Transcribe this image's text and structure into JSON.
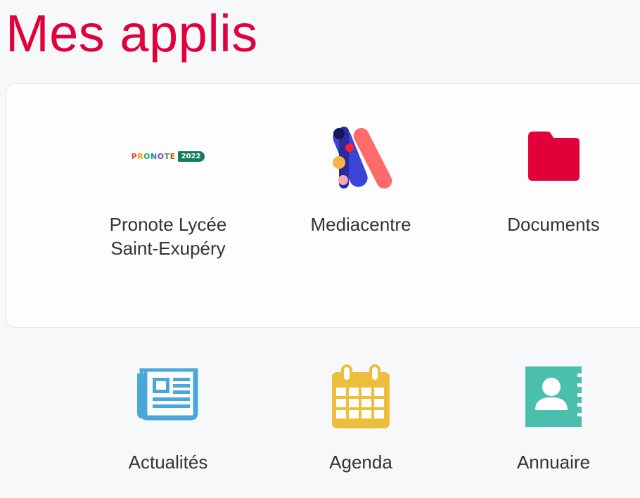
{
  "title": "Mes applis",
  "pronote": {
    "word": "PRONOTE",
    "year": "2022"
  },
  "apps": {
    "pronote": {
      "label_line1": "Pronote Lycée",
      "label_line2": "Saint-Exupéry",
      "icon": "pronote-logo"
    },
    "mediacentre": {
      "label": "Mediacentre",
      "icon": "mediacentre-logo"
    },
    "documents": {
      "label": "Documents",
      "icon": "folder-icon"
    },
    "actualites": {
      "label": "Actualités",
      "icon": "newspaper-icon"
    },
    "agenda": {
      "label": "Agenda",
      "icon": "calendar-icon"
    },
    "annuaire": {
      "label": "Annuaire",
      "icon": "contact-book-icon"
    }
  },
  "colors": {
    "title": "#e0003c",
    "folder": "#e2003b",
    "newspaper": "#4aa8d8",
    "calendar": "#ecbf3a",
    "contacts": "#4bbfae"
  }
}
